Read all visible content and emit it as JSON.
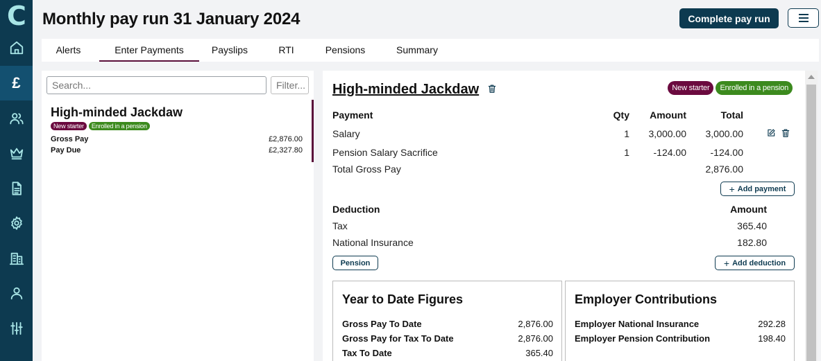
{
  "app": {
    "logo_letter": "C"
  },
  "sidebar": {
    "items": [
      {
        "icon": "home-icon"
      },
      {
        "icon": "pound-icon",
        "label": "£",
        "active": true
      },
      {
        "icon": "people-icon"
      },
      {
        "icon": "crown-icon"
      },
      {
        "icon": "document-icon"
      },
      {
        "icon": "gear-icon"
      },
      {
        "icon": "building-icon"
      },
      {
        "icon": "person-icon"
      },
      {
        "icon": "sliders-icon"
      }
    ]
  },
  "header": {
    "title": "Monthly pay run 31 January 2024",
    "complete_button": "Complete pay run",
    "menu_icon": "hamburger-icon"
  },
  "tabs": [
    {
      "label": "Alerts"
    },
    {
      "label": "Enter Payments",
      "active": true
    },
    {
      "label": "Payslips"
    },
    {
      "label": "RTI"
    },
    {
      "label": "Pensions"
    },
    {
      "label": "Summary"
    }
  ],
  "employee_list": {
    "search_placeholder": "Search...",
    "filter_placeholder": "Filter...",
    "employees": [
      {
        "name": "High-minded Jackdaw",
        "badges": [
          "New starter",
          "Enrolled in a pension"
        ],
        "gross_pay_label": "Gross Pay",
        "gross_pay": "£2,876.00",
        "pay_due_label": "Pay Due",
        "pay_due": "£2,327.80"
      }
    ]
  },
  "detail": {
    "name": "High-minded Jackdaw",
    "badges": [
      "New starter",
      "Enrolled in a pension"
    ],
    "payment_table": {
      "headers": {
        "payment": "Payment",
        "qty": "Qty",
        "amount": "Amount",
        "total": "Total"
      },
      "rows": [
        {
          "name": "Salary",
          "qty": "1",
          "amount": "3,000.00",
          "total": "3,000.00"
        },
        {
          "name": "Pension Salary Sacrifice",
          "qty": "1",
          "amount": "-124.00",
          "total": "-124.00"
        }
      ],
      "total_label": "Total Gross Pay",
      "total_value": "2,876.00",
      "add_button": "Add payment"
    },
    "deduction_table": {
      "headers": {
        "deduction": "Deduction",
        "amount": "Amount"
      },
      "rows": [
        {
          "name": "Tax",
          "amount": "365.40"
        },
        {
          "name": "National Insurance",
          "amount": "182.80"
        }
      ],
      "pension_button": "Pension",
      "add_button": "Add deduction"
    },
    "ytd": {
      "title": "Year to Date Figures",
      "rows": [
        {
          "label": "Gross Pay To Date",
          "value": "2,876.00"
        },
        {
          "label": "Gross Pay for Tax To Date",
          "value": "2,876.00"
        },
        {
          "label": "Tax To Date",
          "value": "365.40"
        }
      ]
    },
    "employer": {
      "title": "Employer Contributions",
      "rows": [
        {
          "label": "Employer National Insurance",
          "value": "292.28"
        },
        {
          "label": "Employer Pension Contribution",
          "value": "198.40"
        }
      ]
    }
  },
  "colors": {
    "sidebar_bg": "#0d3a50",
    "sidebar_active": "#135070",
    "icon_accent": "#a8e5e6",
    "new_starter_badge": "#6b0a3f",
    "pension_badge": "#3c8a1e",
    "tab_underline": "#5a0f3a"
  }
}
